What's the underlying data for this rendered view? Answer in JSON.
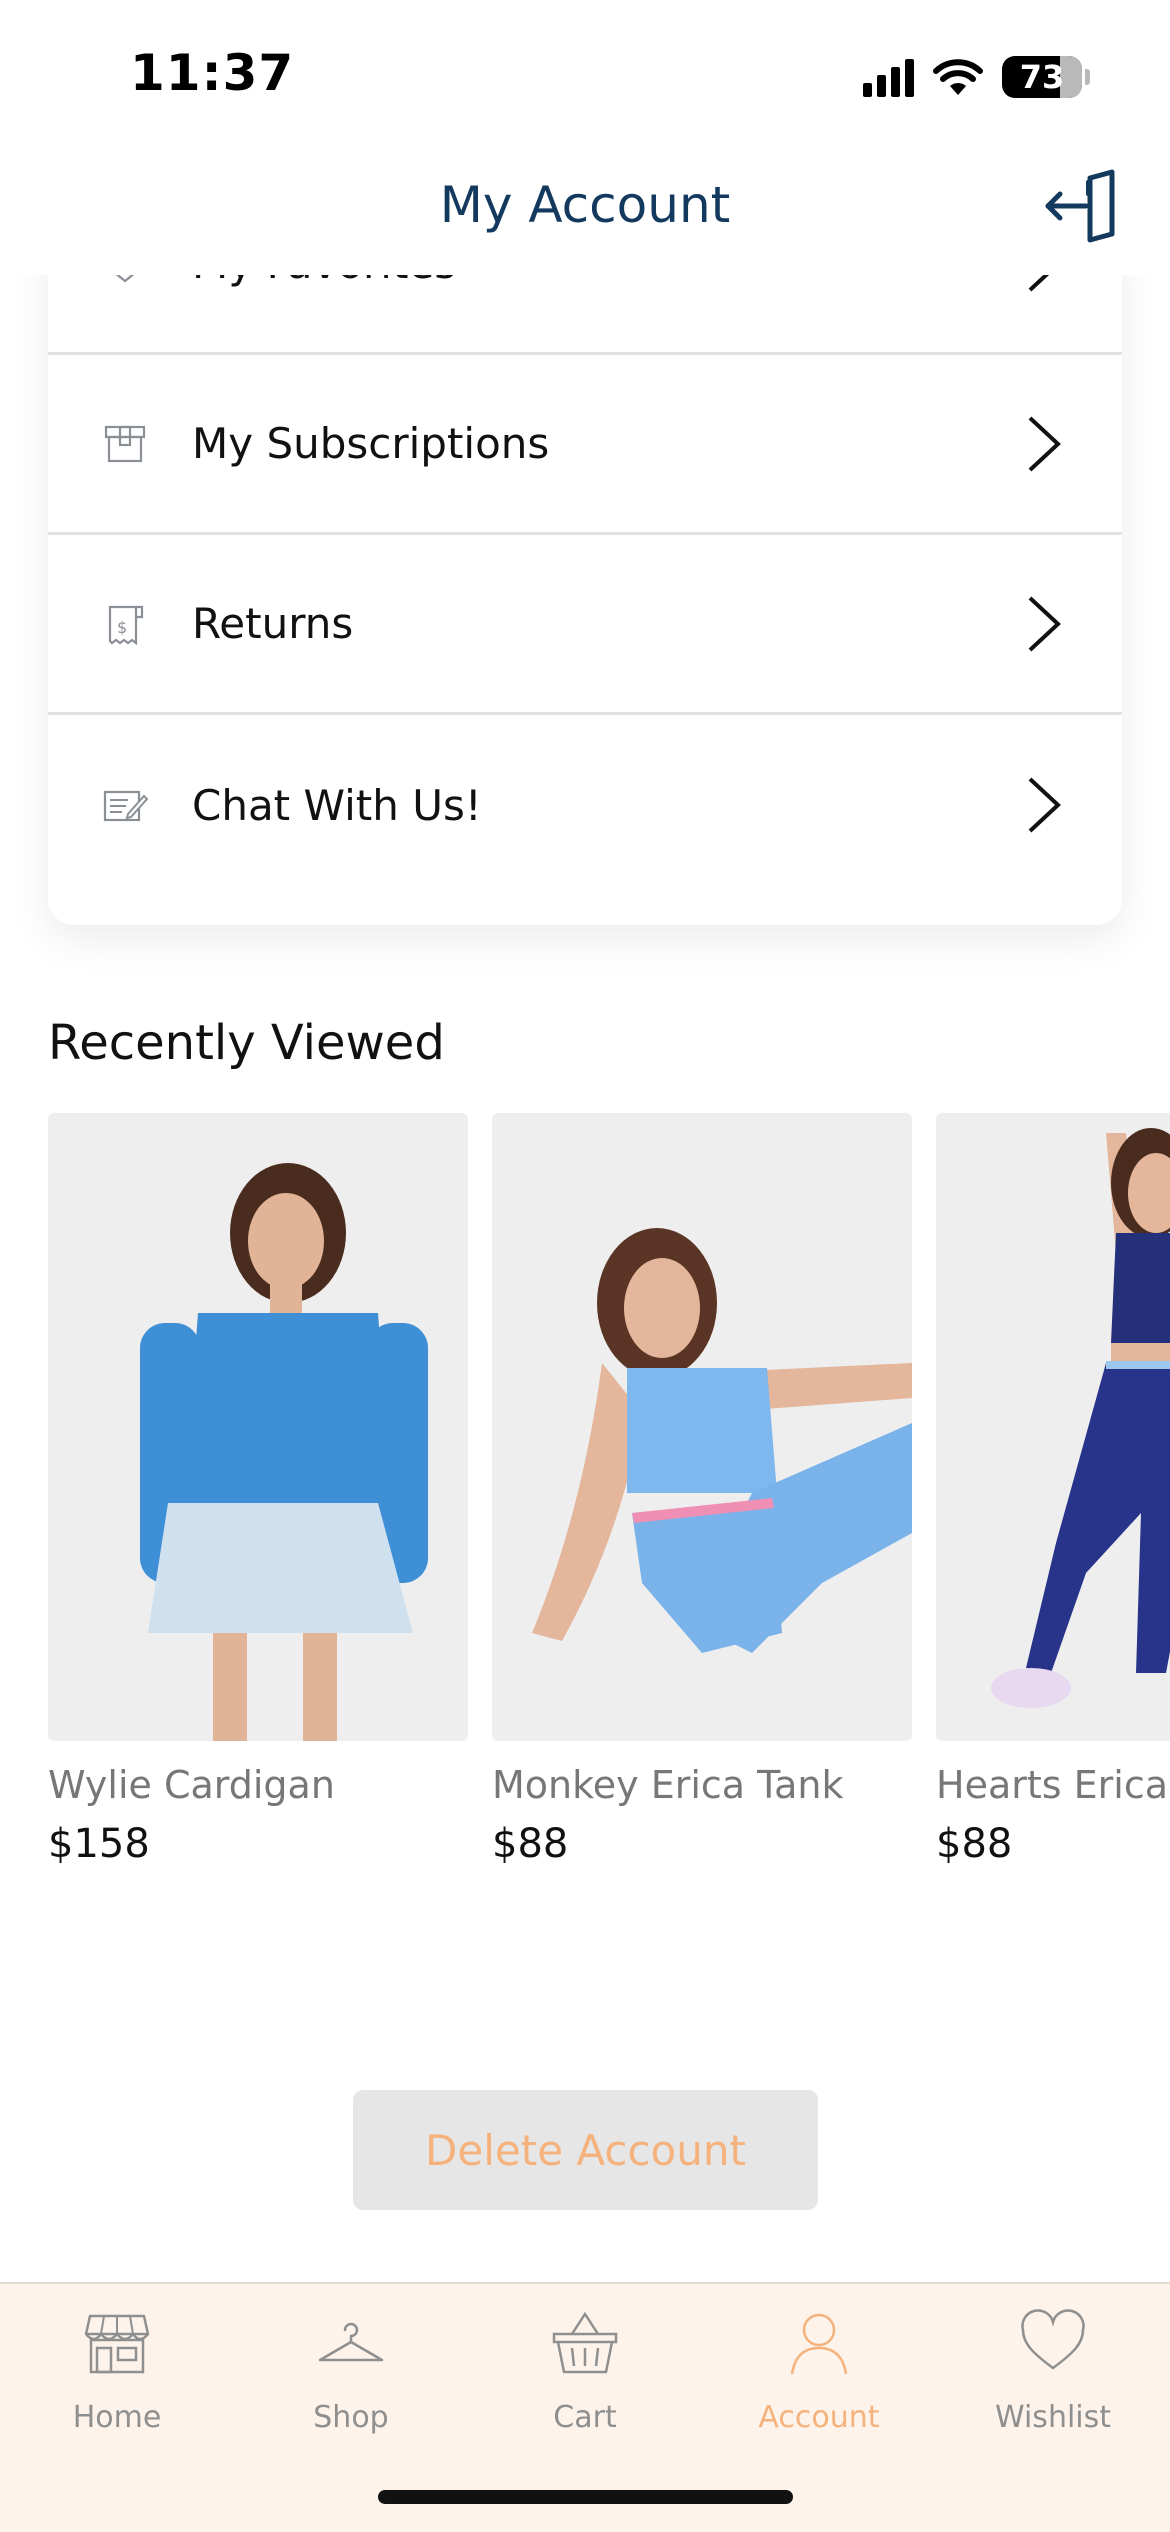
{
  "status_bar": {
    "time": "11:37",
    "battery": "73"
  },
  "header": {
    "title": "My Account",
    "logout_icon": "logout-icon"
  },
  "menu": {
    "items": [
      {
        "label": "My Favorites",
        "icon": "heart-icon"
      },
      {
        "label": "My Subscriptions",
        "icon": "box-icon"
      },
      {
        "label": "Returns",
        "icon": "receipt-icon"
      },
      {
        "label": "Chat With Us!",
        "icon": "edit-note-icon"
      }
    ]
  },
  "recently_viewed": {
    "title": "Recently Viewed",
    "products": [
      {
        "name": "Wylie Cardigan",
        "price": "$158",
        "colors": {
          "top": "#3f8fd6",
          "bottom": "#cfe0ef"
        }
      },
      {
        "name": "Monkey Erica Tank",
        "price": "$88",
        "colors": {
          "top": "#7fb8ee",
          "bottom": "#79b3ea"
        }
      },
      {
        "name": "Hearts Erica Tank",
        "price": "$88",
        "colors": {
          "top": "#25307a",
          "bottom": "#27348a"
        }
      }
    ]
  },
  "actions": {
    "delete_account": "Delete Account"
  },
  "tab_bar": {
    "tabs": [
      {
        "label": "Home",
        "icon": "storefront-icon"
      },
      {
        "label": "Shop",
        "icon": "hanger-icon"
      },
      {
        "label": "Cart",
        "icon": "basket-icon"
      },
      {
        "label": "Account",
        "icon": "person-icon",
        "active": true
      },
      {
        "label": "Wishlist",
        "icon": "heart-icon"
      }
    ],
    "active_color": "#f5b27c",
    "inactive_color": "#8f8f8f"
  }
}
